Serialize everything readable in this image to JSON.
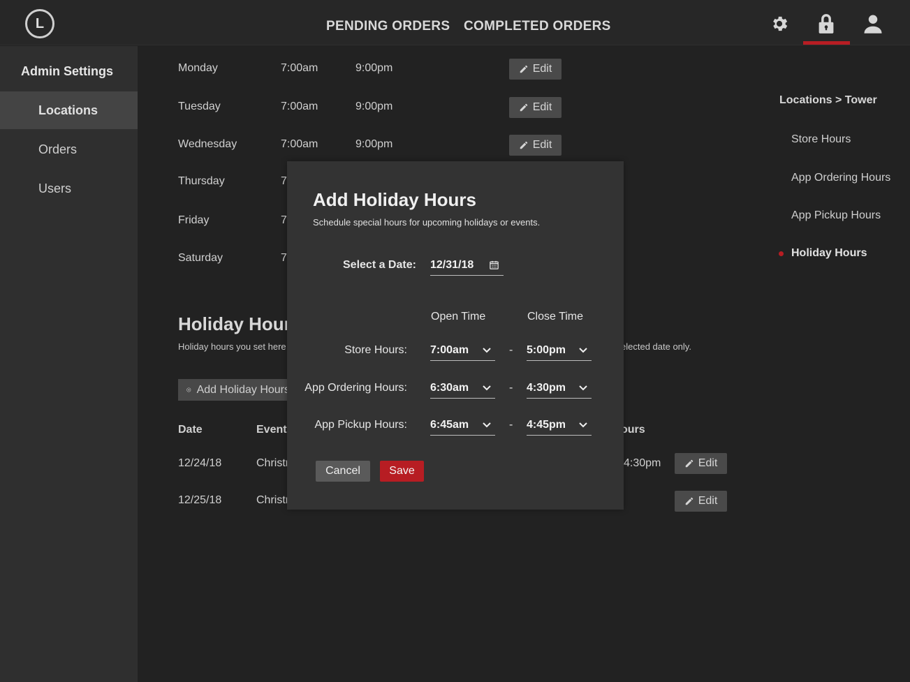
{
  "header": {
    "logo_letter": "L",
    "nav": [
      "PENDING ORDERS",
      "COMPLETED ORDERS"
    ],
    "icons": [
      "gear-icon",
      "lock-icon",
      "user-icon"
    ],
    "accent": "#b71d23"
  },
  "sidebar": {
    "title": "Admin Settings",
    "items": [
      {
        "label": "Locations",
        "active": true
      },
      {
        "label": "Orders",
        "active": false
      },
      {
        "label": "Users",
        "active": false
      }
    ]
  },
  "week": [
    {
      "day": "Monday",
      "open": "7:00am",
      "close": "9:00pm",
      "edit": "Edit"
    },
    {
      "day": "Tuesday",
      "open": "7:00am",
      "close": "9:00pm",
      "edit": "Edit"
    },
    {
      "day": "Wednesday",
      "open": "7:00am",
      "close": "9:00pm",
      "edit": "Edit"
    },
    {
      "day": "Thursday",
      "open": "7"
    },
    {
      "day": "Friday",
      "open": "7"
    },
    {
      "day": "Saturday",
      "open": "7"
    }
  ],
  "holiday": {
    "title": "Holiday Hours",
    "desc_left": "Holiday hours you set here w",
    "desc_right": "elected date only.",
    "add_button": "Add Holiday Hours",
    "columns": {
      "date": "Date",
      "event": "Event",
      "hours_partial": "ours"
    },
    "rows": [
      {
        "date": "12/24/18",
        "event": "Christr",
        "time": "4:30pm",
        "edit": "Edit"
      },
      {
        "date": "12/25/18",
        "event": "Christr",
        "time": "",
        "edit": "Edit"
      }
    ]
  },
  "right_nav": {
    "breadcrumb": "Locations > Tower",
    "items": [
      {
        "label": "Store Hours",
        "active": false
      },
      {
        "label": "App Ordering Hours",
        "active": false
      },
      {
        "label": "App Pickup Hours",
        "active": false
      },
      {
        "label": "Holiday Hours",
        "active": true
      }
    ]
  },
  "modal": {
    "title": "Add Holiday Hours",
    "subtitle": "Schedule special hours for upcoming holidays or events.",
    "date_label": "Select a Date:",
    "date_value": "12/31/18",
    "open_col": "Open Time",
    "close_col": "Close Time",
    "rows": [
      {
        "label": "Store Hours:",
        "open": "7:00am",
        "close": "5:00pm"
      },
      {
        "label": "App Ordering Hours:",
        "open": "6:30am",
        "close": "4:30pm"
      },
      {
        "label": "App Pickup Hours:",
        "open": "6:45am",
        "close": "4:45pm"
      }
    ],
    "separator": "-",
    "cancel": "Cancel",
    "save": "Save"
  }
}
